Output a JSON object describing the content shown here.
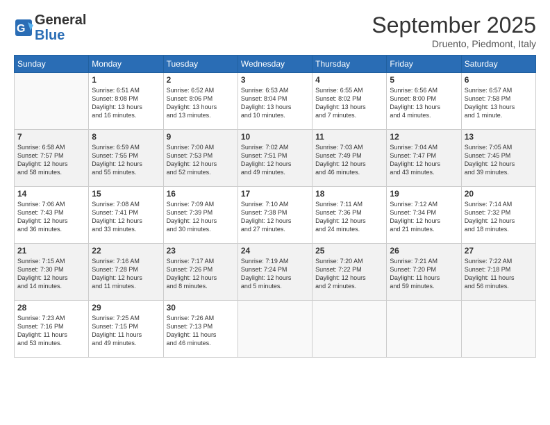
{
  "header": {
    "logo_general": "General",
    "logo_blue": "Blue",
    "month": "September 2025",
    "location": "Druento, Piedmont, Italy"
  },
  "weekdays": [
    "Sunday",
    "Monday",
    "Tuesday",
    "Wednesday",
    "Thursday",
    "Friday",
    "Saturday"
  ],
  "weeks": [
    [
      {
        "day": "",
        "info": ""
      },
      {
        "day": "1",
        "info": "Sunrise: 6:51 AM\nSunset: 8:08 PM\nDaylight: 13 hours\nand 16 minutes."
      },
      {
        "day": "2",
        "info": "Sunrise: 6:52 AM\nSunset: 8:06 PM\nDaylight: 13 hours\nand 13 minutes."
      },
      {
        "day": "3",
        "info": "Sunrise: 6:53 AM\nSunset: 8:04 PM\nDaylight: 13 hours\nand 10 minutes."
      },
      {
        "day": "4",
        "info": "Sunrise: 6:55 AM\nSunset: 8:02 PM\nDaylight: 13 hours\nand 7 minutes."
      },
      {
        "day": "5",
        "info": "Sunrise: 6:56 AM\nSunset: 8:00 PM\nDaylight: 13 hours\nand 4 minutes."
      },
      {
        "day": "6",
        "info": "Sunrise: 6:57 AM\nSunset: 7:58 PM\nDaylight: 13 hours\nand 1 minute."
      }
    ],
    [
      {
        "day": "7",
        "info": "Sunrise: 6:58 AM\nSunset: 7:57 PM\nDaylight: 12 hours\nand 58 minutes."
      },
      {
        "day": "8",
        "info": "Sunrise: 6:59 AM\nSunset: 7:55 PM\nDaylight: 12 hours\nand 55 minutes."
      },
      {
        "day": "9",
        "info": "Sunrise: 7:00 AM\nSunset: 7:53 PM\nDaylight: 12 hours\nand 52 minutes."
      },
      {
        "day": "10",
        "info": "Sunrise: 7:02 AM\nSunset: 7:51 PM\nDaylight: 12 hours\nand 49 minutes."
      },
      {
        "day": "11",
        "info": "Sunrise: 7:03 AM\nSunset: 7:49 PM\nDaylight: 12 hours\nand 46 minutes."
      },
      {
        "day": "12",
        "info": "Sunrise: 7:04 AM\nSunset: 7:47 PM\nDaylight: 12 hours\nand 43 minutes."
      },
      {
        "day": "13",
        "info": "Sunrise: 7:05 AM\nSunset: 7:45 PM\nDaylight: 12 hours\nand 39 minutes."
      }
    ],
    [
      {
        "day": "14",
        "info": "Sunrise: 7:06 AM\nSunset: 7:43 PM\nDaylight: 12 hours\nand 36 minutes."
      },
      {
        "day": "15",
        "info": "Sunrise: 7:08 AM\nSunset: 7:41 PM\nDaylight: 12 hours\nand 33 minutes."
      },
      {
        "day": "16",
        "info": "Sunrise: 7:09 AM\nSunset: 7:39 PM\nDaylight: 12 hours\nand 30 minutes."
      },
      {
        "day": "17",
        "info": "Sunrise: 7:10 AM\nSunset: 7:38 PM\nDaylight: 12 hours\nand 27 minutes."
      },
      {
        "day": "18",
        "info": "Sunrise: 7:11 AM\nSunset: 7:36 PM\nDaylight: 12 hours\nand 24 minutes."
      },
      {
        "day": "19",
        "info": "Sunrise: 7:12 AM\nSunset: 7:34 PM\nDaylight: 12 hours\nand 21 minutes."
      },
      {
        "day": "20",
        "info": "Sunrise: 7:14 AM\nSunset: 7:32 PM\nDaylight: 12 hours\nand 18 minutes."
      }
    ],
    [
      {
        "day": "21",
        "info": "Sunrise: 7:15 AM\nSunset: 7:30 PM\nDaylight: 12 hours\nand 14 minutes."
      },
      {
        "day": "22",
        "info": "Sunrise: 7:16 AM\nSunset: 7:28 PM\nDaylight: 12 hours\nand 11 minutes."
      },
      {
        "day": "23",
        "info": "Sunrise: 7:17 AM\nSunset: 7:26 PM\nDaylight: 12 hours\nand 8 minutes."
      },
      {
        "day": "24",
        "info": "Sunrise: 7:19 AM\nSunset: 7:24 PM\nDaylight: 12 hours\nand 5 minutes."
      },
      {
        "day": "25",
        "info": "Sunrise: 7:20 AM\nSunset: 7:22 PM\nDaylight: 12 hours\nand 2 minutes."
      },
      {
        "day": "26",
        "info": "Sunrise: 7:21 AM\nSunset: 7:20 PM\nDaylight: 11 hours\nand 59 minutes."
      },
      {
        "day": "27",
        "info": "Sunrise: 7:22 AM\nSunset: 7:18 PM\nDaylight: 11 hours\nand 56 minutes."
      }
    ],
    [
      {
        "day": "28",
        "info": "Sunrise: 7:23 AM\nSunset: 7:16 PM\nDaylight: 11 hours\nand 53 minutes."
      },
      {
        "day": "29",
        "info": "Sunrise: 7:25 AM\nSunset: 7:15 PM\nDaylight: 11 hours\nand 49 minutes."
      },
      {
        "day": "30",
        "info": "Sunrise: 7:26 AM\nSunset: 7:13 PM\nDaylight: 11 hours\nand 46 minutes."
      },
      {
        "day": "",
        "info": ""
      },
      {
        "day": "",
        "info": ""
      },
      {
        "day": "",
        "info": ""
      },
      {
        "day": "",
        "info": ""
      }
    ]
  ]
}
